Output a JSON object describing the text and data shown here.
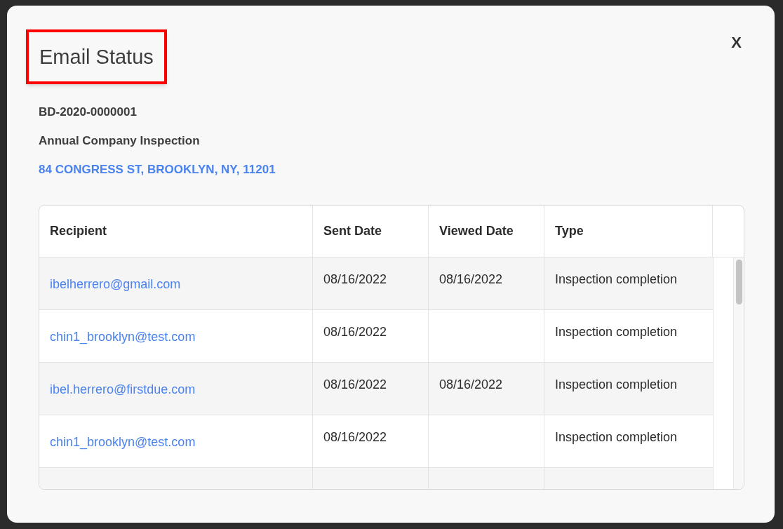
{
  "dialog": {
    "title": "Email Status",
    "close": "X"
  },
  "record": {
    "number": "BD-2020-0000001",
    "name": "Annual Company Inspection",
    "address": "84 CONGRESS ST, BROOKLYN, NY, 11201"
  },
  "table": {
    "columns": [
      "Recipient",
      "Sent Date",
      "Viewed Date",
      "Type"
    ],
    "rows": [
      {
        "recipient": "ibelherrero@gmail.com",
        "sent_date": "08/16/2022",
        "viewed_date": "08/16/2022",
        "type": "Inspection completion"
      },
      {
        "recipient": "chin1_brooklyn@test.com",
        "sent_date": "08/16/2022",
        "type": "Inspection completion"
      },
      {
        "recipient": "ibel.herrero@firstdue.com",
        "sent_date": "08/16/2022",
        "viewed_date": "08/16/2022",
        "type": "Inspection completion"
      },
      {
        "recipient": "chin1_brooklyn@test.com",
        "sent_date": "08/16/2022",
        "type": "Inspection completion"
      }
    ]
  }
}
